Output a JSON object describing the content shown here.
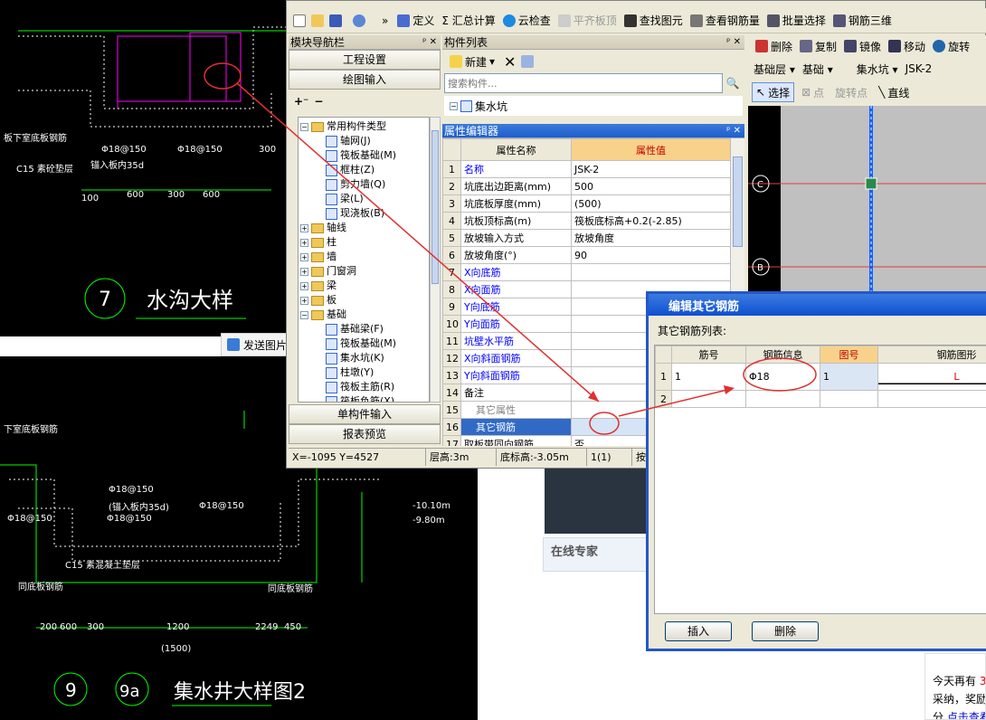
{
  "cad_top": {
    "label_steel": "板下室底板钢筋",
    "label_c15": "C15 素砼垫层",
    "label_anchor": "锚入板内35d",
    "rebar_1": "Φ18@150",
    "rebar_2": "Φ18@150",
    "dims": [
      "100",
      "600",
      "300",
      "600",
      "300"
    ],
    "detail_no": "7",
    "detail_title": "水沟大样"
  },
  "send_image_label": "发送图片",
  "cad_bottom": {
    "labels": [
      "下室底板钢筋",
      "Φ18@150",
      "Φ18@150",
      "Φ18@150",
      "C15 素混凝土垫层",
      "同底板钢筋",
      "同底板钢筋",
      "(锚入板内35d)",
      "Φ18@150"
    ],
    "dims_bottom": [
      "200",
      "600",
      "300",
      "1200",
      "2249",
      "450"
    ],
    "total": "(1500)",
    "elev1": "-10.10m",
    "elev2": "-9.80m",
    "detail_no": "9",
    "detail_no2": "9a",
    "detail_title": "集水井大样图2"
  },
  "toolbar": {
    "items": [
      "定义",
      "Σ 汇总计算",
      "云检查",
      "平齐板顶",
      "查找图元",
      "查看钢筋量",
      "批量选择",
      "钢筋三维"
    ]
  },
  "toolbar2": {
    "items": [
      "删除",
      "复制",
      "镜像",
      "移动",
      "旋转"
    ],
    "floor": "基础层",
    "category": "基础",
    "type": "集水坑",
    "name": "JSK-2",
    "select": "选择",
    "point": "点",
    "rotate_point": "旋转点",
    "line": "直线"
  },
  "module_nav": {
    "title": "模块导航栏",
    "btn_project": "工程设置",
    "btn_draw": "绘图输入",
    "tree": [
      {
        "label": "常用构件类型",
        "level": 1,
        "type": "folder-open"
      },
      {
        "label": "轴网(J)",
        "level": 2,
        "type": "item"
      },
      {
        "label": "筏板基础(M)",
        "level": 2,
        "type": "item"
      },
      {
        "label": "框柱(Z)",
        "level": 2,
        "type": "item"
      },
      {
        "label": "剪力墙(Q)",
        "level": 2,
        "type": "item"
      },
      {
        "label": "梁(L)",
        "level": 2,
        "type": "item"
      },
      {
        "label": "现浇板(B)",
        "level": 2,
        "type": "item"
      },
      {
        "label": "轴线",
        "level": 1,
        "type": "folder"
      },
      {
        "label": "柱",
        "level": 1,
        "type": "folder"
      },
      {
        "label": "墙",
        "level": 1,
        "type": "folder"
      },
      {
        "label": "门窗洞",
        "level": 1,
        "type": "folder"
      },
      {
        "label": "梁",
        "level": 1,
        "type": "folder"
      },
      {
        "label": "板",
        "level": 1,
        "type": "folder"
      },
      {
        "label": "基础",
        "level": 1,
        "type": "folder-open"
      },
      {
        "label": "基础梁(F)",
        "level": 2,
        "type": "item"
      },
      {
        "label": "筏板基础(M)",
        "level": 2,
        "type": "item"
      },
      {
        "label": "集水坑(K)",
        "level": 2,
        "type": "item"
      },
      {
        "label": "柱墩(Y)",
        "level": 2,
        "type": "item"
      },
      {
        "label": "筏板主筋(R)",
        "level": 2,
        "type": "item"
      },
      {
        "label": "筏板负筋(X)",
        "level": 2,
        "type": "item"
      }
    ],
    "btn_single": "单构件输入",
    "btn_report": "报表预览"
  },
  "component_list": {
    "title": "构件列表",
    "new_label": "新建",
    "search_placeholder": "搜索构件...",
    "root_item": "集水坑"
  },
  "property_editor": {
    "title": "属性编辑器",
    "col_name": "属性名称",
    "col_value": "属性值",
    "rows": [
      {
        "no": "1",
        "name": "名称",
        "value": "JSK-2",
        "style": "blue"
      },
      {
        "no": "2",
        "name": "坑底出边距离(mm)",
        "value": "500",
        "style": ""
      },
      {
        "no": "3",
        "name": "坑底板厚度(mm)",
        "value": "(500)",
        "style": ""
      },
      {
        "no": "4",
        "name": "坑板顶标高(m)",
        "value": "筏板底标高+0.2(-2.85)",
        "style": ""
      },
      {
        "no": "5",
        "name": "放坡输入方式",
        "value": "放坡角度",
        "style": ""
      },
      {
        "no": "6",
        "name": "放坡角度(°)",
        "value": "90",
        "style": ""
      },
      {
        "no": "7",
        "name": "X向底筋",
        "value": "",
        "style": "blue"
      },
      {
        "no": "8",
        "name": "X向面筋",
        "value": "",
        "style": "blue"
      },
      {
        "no": "9",
        "name": "Y向底筋",
        "value": "",
        "style": "blue"
      },
      {
        "no": "10",
        "name": "Y向面筋",
        "value": "",
        "style": "blue"
      },
      {
        "no": "11",
        "name": "坑壁水平筋",
        "value": "",
        "style": "blue"
      },
      {
        "no": "12",
        "name": "X向斜面钢筋",
        "value": "",
        "style": "blue"
      },
      {
        "no": "13",
        "name": "Y向斜面钢筋",
        "value": "",
        "style": "blue"
      },
      {
        "no": "14",
        "name": "备注",
        "value": "",
        "style": ""
      },
      {
        "no": "15",
        "name": "其它属性",
        "value": "",
        "style": "gray"
      },
      {
        "no": "16",
        "name": "其它钢筋",
        "value": "",
        "style": "sel"
      },
      {
        "no": "17",
        "name": "取板带同向钢筋",
        "value": "否",
        "style": ""
      }
    ]
  },
  "statusbar": {
    "coords": "X=-1095 Y=4527",
    "floor_height": "层高:3m",
    "bottom_elev": "底标高:-3.05m",
    "count": "1(1)",
    "extra": "按"
  },
  "dialog": {
    "title": "编辑其它钢筋",
    "list_label": "其它钢筋列表:",
    "headers": [
      "筋号",
      "钢筋信息",
      "图号",
      "钢筋图形"
    ],
    "rows": [
      {
        "no": "1",
        "bar": "1",
        "info": "Φ18",
        "fig": "1",
        "shape": "L"
      },
      {
        "no": "2",
        "bar": "",
        "info": "",
        "fig": "",
        "shape": ""
      }
    ],
    "btn_insert": "插入",
    "btn_delete": "删除"
  },
  "web": {
    "online_expert": "在线专家",
    "notice_line1_prefix": "今天再有",
    "notice_line1_num": "3",
    "notice_line2": "采纳，奖励",
    "notice_line3_prefix": "分,",
    "notice_line3_link": "点击查看"
  },
  "cad_right": {
    "axis_c": "C",
    "axis_b": "B"
  }
}
